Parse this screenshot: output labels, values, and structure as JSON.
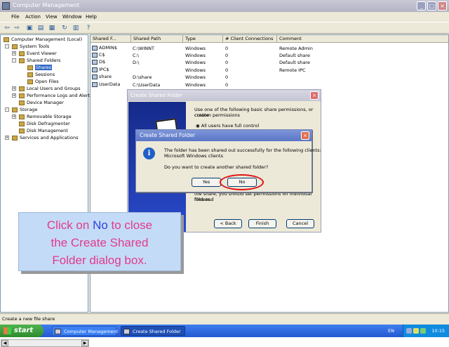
{
  "window": {
    "title": "Computer Management"
  },
  "menu": [
    "File",
    "Action",
    "View",
    "Window",
    "Help"
  ],
  "tree": [
    {
      "label": "Computer Management (Local)"
    },
    {
      "label": "System Tools"
    },
    {
      "label": "Event Viewer"
    },
    {
      "label": "Shared Folders"
    },
    {
      "label": "Shares"
    },
    {
      "label": "Sessions"
    },
    {
      "label": "Open Files"
    },
    {
      "label": "Local Users and Groups"
    },
    {
      "label": "Performance Logs and Alerts"
    },
    {
      "label": "Device Manager"
    },
    {
      "label": "Storage"
    },
    {
      "label": "Removable Storage"
    },
    {
      "label": "Disk Defragmenter"
    },
    {
      "label": "Disk Management"
    },
    {
      "label": "Services and Applications"
    }
  ],
  "list": {
    "columns": [
      "Shared F...",
      "Shared Path",
      "Type",
      "# Client Connections",
      "Comment"
    ],
    "rows": [
      [
        "ADMIN$",
        "C:\\WINNT",
        "Windows",
        "0",
        "Remote Admin"
      ],
      [
        "C$",
        "C:\\",
        "Windows",
        "0",
        "Default share"
      ],
      [
        "D$",
        "D:\\",
        "Windows",
        "0",
        "Default share"
      ],
      [
        "IPC$",
        "",
        "Windows",
        "0",
        "Remote IPC"
      ],
      [
        "share",
        "D:\\share",
        "Windows",
        "0",
        ""
      ],
      [
        "UserData",
        "C:\\UserData",
        "Windows",
        "0",
        ""
      ]
    ]
  },
  "status": "Create a new file share",
  "taskbar": {
    "start": "start",
    "tasks": [
      "Computer Management",
      "Create Shared Folder"
    ],
    "lang": "EN",
    "clock": "10:15"
  },
  "wizard": {
    "title": "Create Shared Folder",
    "text1": "Use one of the following basic share permissions, or create",
    "text2": "custom permissions",
    "option": "All users have full control",
    "bottom1": "the share, you should set permissions on individual files and",
    "bottom2": "folders.",
    "back": "< Back",
    "finish": "Finish",
    "cancel": "Cancel"
  },
  "dialog": {
    "title": "Create Shared Folder",
    "line1": "The folder has been shared out successfully for the following clients:",
    "line2": "Microsoft Windows clients",
    "question": "Do you want to create another shared folder?",
    "yes": "Yes",
    "no": "No"
  },
  "callout": {
    "l1a": "Click on ",
    "l1b": "No",
    "l1c": " to close",
    "l2": "the Create Shared",
    "l3": "Folder dialog box."
  },
  "colors": {
    "highlight_ring": "#e01010",
    "callout_bg": "#c4dbf7",
    "callout_text": "#e23a8c"
  }
}
